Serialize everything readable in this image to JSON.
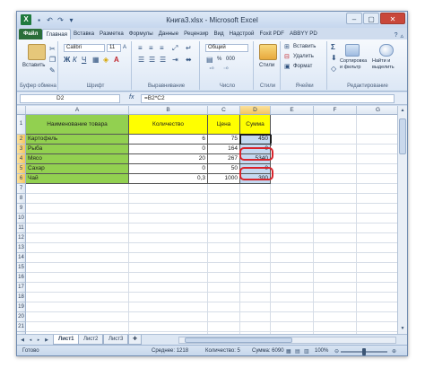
{
  "app": {
    "logo": "X",
    "title": "Книга3.xlsx - Microsoft Excel",
    "qat_icons": [
      "save-icon",
      "undo-icon",
      "redo-icon",
      "dropdown-icon"
    ],
    "window_buttons": [
      "–",
      "▢",
      "✕"
    ]
  },
  "tabs": [
    "Файл",
    "Главная",
    "Вставка",
    "Разметка",
    "Формулы",
    "Данные",
    "Рецензир",
    "Вид",
    "Надстрой",
    "Foxit PDF",
    "ABBYY PD"
  ],
  "active_tab": "Главная",
  "ribbon": {
    "clipboard": {
      "paste": "Вставить",
      "label": "Буфер обмена"
    },
    "font": {
      "name": "Calibri",
      "size": "11",
      "label": "Шрифт"
    },
    "alignment": {
      "label": "Выравнивание"
    },
    "number": {
      "format": "Общий",
      "currency": "%",
      "percent": "000",
      "label": "Число"
    },
    "styles": {
      "label": "Стили",
      "button": "Стили"
    },
    "cells": {
      "insert": "Вставить",
      "delete": "Удалить",
      "format": "Формат",
      "label": "Ячейки"
    },
    "editing": {
      "sigma": "Σ",
      "sort": "Сортировка и фильтр",
      "find": "Найти и выделить",
      "label": "Редактирование"
    }
  },
  "formula_bar": {
    "name_box": "D2",
    "fx": "fx",
    "formula": "=B2*C2"
  },
  "grid": {
    "columns": [
      "A",
      "B",
      "C",
      "D",
      "E",
      "F",
      "G"
    ],
    "rows": [
      "1",
      "2",
      "3",
      "4",
      "5",
      "6",
      "7",
      "8",
      "9",
      "10",
      "11",
      "12",
      "13",
      "14",
      "15",
      "16",
      "17",
      "18",
      "19",
      "20",
      "21",
      "22"
    ],
    "headers": [
      "Наименование товара",
      "Количество",
      "Цена",
      "Сумма"
    ],
    "data": [
      [
        "Картофель",
        "6",
        "75",
        "450"
      ],
      [
        "Рыба",
        "0",
        "164",
        "0"
      ],
      [
        "Мясо",
        "20",
        "267",
        "5340"
      ],
      [
        "Сахар",
        "0",
        "50",
        "0"
      ],
      [
        "Чай",
        "0,3",
        "1000",
        "300"
      ]
    ]
  },
  "sheets": [
    "Лист1",
    "Лист2",
    "Лист3"
  ],
  "status": {
    "ready": "Готово",
    "average": "Среднее: 1218",
    "count": "Количество: 5",
    "sum": "Сумма: 6090",
    "zoom": "100%"
  },
  "colors": {
    "highlight_green": "#92d050",
    "highlight_yellow": "#ffff00",
    "annotation_red": "#d9242c"
  }
}
